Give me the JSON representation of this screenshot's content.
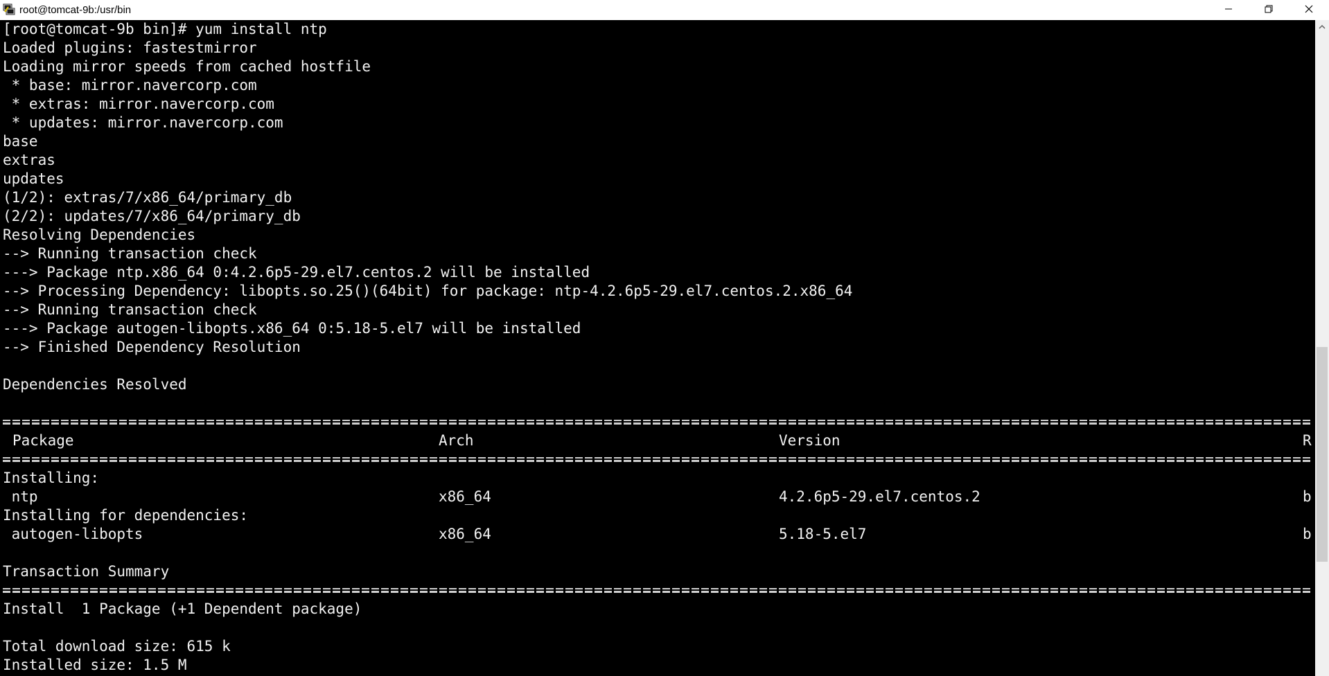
{
  "window": {
    "title": "root@tomcat-9b:/usr/bin",
    "icons": {
      "app": "putty-terminal-icon",
      "minimize": "minimize-icon",
      "restore": "restore-icon",
      "close": "close-icon",
      "scroll_up": "chevron-up-icon"
    }
  },
  "terminal": {
    "lines": [
      "[root@tomcat-9b bin]# yum install ntp",
      "Loaded plugins: fastestmirror",
      "Loading mirror speeds from cached hostfile",
      " * base: mirror.navercorp.com",
      " * extras: mirror.navercorp.com",
      " * updates: mirror.navercorp.com",
      "base",
      "extras",
      "updates",
      "(1/2): extras/7/x86_64/primary_db",
      "(2/2): updates/7/x86_64/primary_db",
      "Resolving Dependencies",
      "--> Running transaction check",
      "---> Package ntp.x86_64 0:4.2.6p5-29.el7.centos.2 will be installed",
      "--> Processing Dependency: libopts.so.25()(64bit) for package: ntp-4.2.6p5-29.el7.centos.2.x86_64",
      "--> Running transaction check",
      "---> Package autogen-libopts.x86_64 0:5.18-5.el7 will be installed",
      "--> Finished Dependency Resolution",
      "",
      "Dependencies Resolved"
    ],
    "table": {
      "header": [
        "Package",
        "Arch",
        "Version",
        "R"
      ],
      "installing_label": "Installing:",
      "installing_row": [
        " ntp",
        "x86_64",
        "4.2.6p5-29.el7.centos.2",
        "b"
      ],
      "deps_label": "Installing for dependencies:",
      "deps_row": [
        " autogen-libopts",
        "x86_64",
        "5.18-5.el7",
        "b"
      ]
    },
    "summary_title": "Transaction Summary",
    "summary_line": "Install  1 Package (+1 Dependent package)",
    "download_size": "Total download size: 615 k",
    "installed_size": "Installed size: 1.5 M"
  }
}
